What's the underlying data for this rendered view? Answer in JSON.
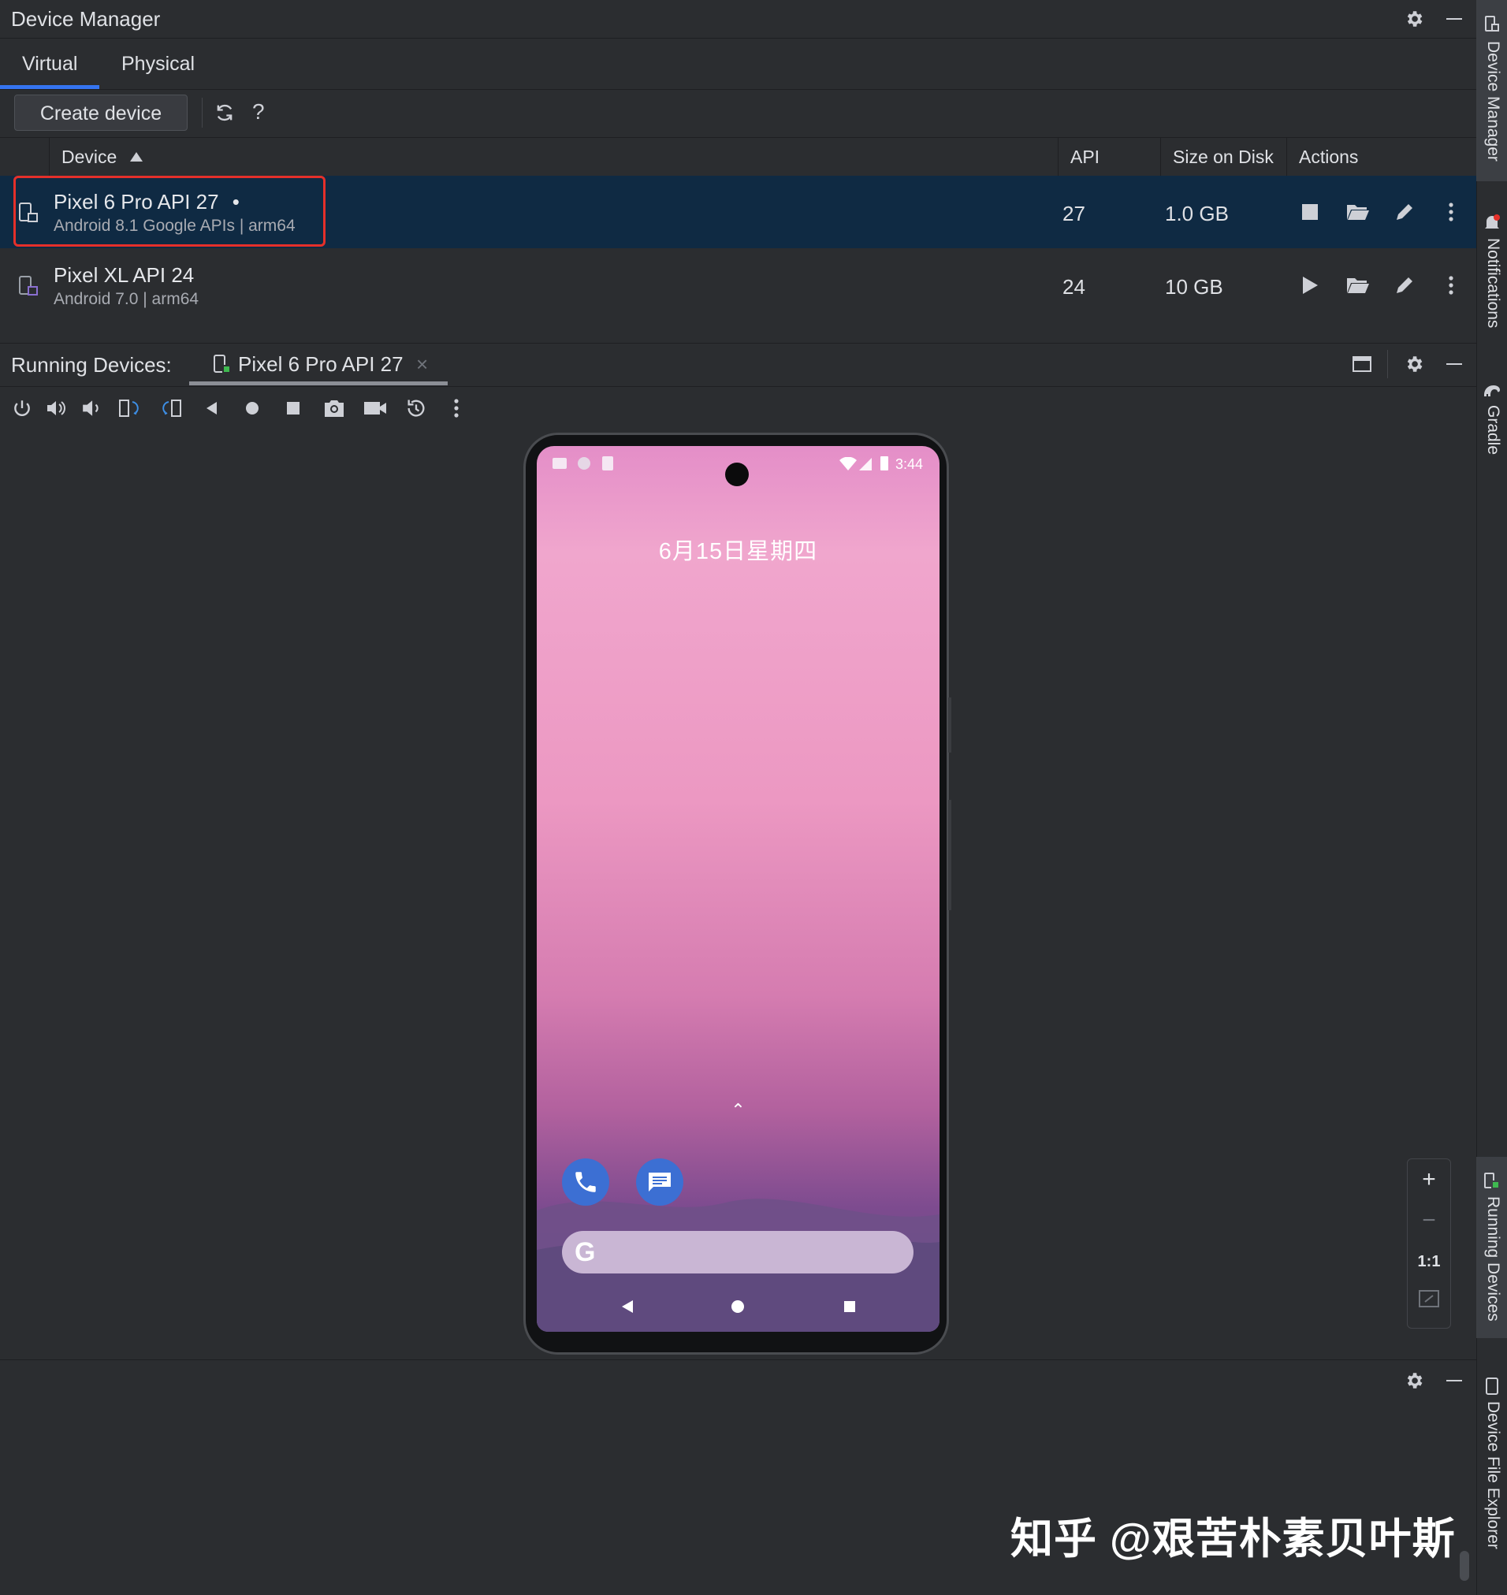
{
  "device_manager": {
    "title": "Device Manager",
    "tabs": [
      {
        "label": "Virtual",
        "active": true
      },
      {
        "label": "Physical",
        "active": false
      }
    ],
    "create_device_label": "Create device",
    "help_label": "?",
    "table": {
      "columns": [
        "Device",
        "API",
        "Size on Disk",
        "Actions"
      ],
      "sort_indicator": "ascending",
      "rows": [
        {
          "name": "Pixel 6 Pro API 27",
          "running_dot": "•",
          "details": "Android 8.1 Google APIs | arm64",
          "api": "27",
          "size": "1.0 GB",
          "primary_action": "stop-icon",
          "selected": true
        },
        {
          "name": "Pixel XL API 24",
          "running_dot": "",
          "details": "Android 7.0 | arm64",
          "api": "24",
          "size": "10 GB",
          "primary_action": "play-icon",
          "selected": false
        }
      ]
    }
  },
  "running_devices": {
    "label": "Running Devices:",
    "tab_label": "Pixel 6 Pro API 27",
    "close_glyph": "×",
    "toolbar_icons": [
      "power-icon",
      "volume-up-icon",
      "volume-down-icon",
      "rotate-left-icon",
      "rotate-right-icon",
      "back-icon",
      "home-icon",
      "overview-icon",
      "screenshot-icon",
      "screen-record-icon",
      "snapshot-icon",
      "more-icon"
    ]
  },
  "emulator_screen": {
    "clock": "3:44",
    "date": "6月15日星期四",
    "swipe_up_glyph": "⌃",
    "search_logo": "G"
  },
  "zoom_controls": {
    "zoom_in": "+",
    "zoom_out": "−",
    "actual_size": "1:1"
  },
  "side_stripe": {
    "items": [
      "Device Manager",
      "Notifications",
      "Gradle",
      "Running Devices",
      "Device File Explorer"
    ]
  },
  "watermark": "知乎 @艰苦朴素贝叶斯",
  "colors": {
    "selection": "#0f2a43",
    "accent_tab": "#3574f0",
    "highlight_box": "#e5302a"
  }
}
